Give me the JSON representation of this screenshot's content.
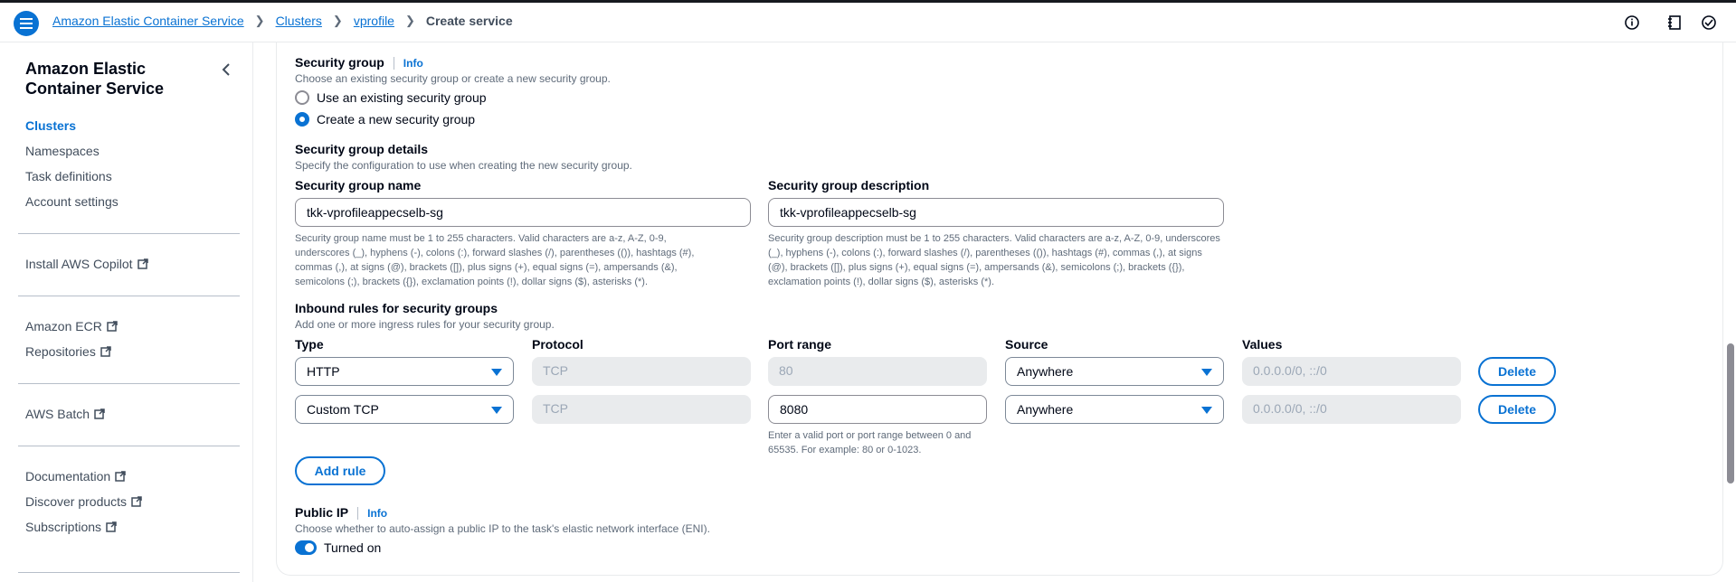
{
  "header": {
    "breadcrumb": [
      "Amazon Elastic Container Service",
      "Clusters",
      "vprofile",
      "Create service"
    ],
    "accent_color": "#0972d3"
  },
  "sidebar": {
    "title": "Amazon Elastic Container Service",
    "items": [
      {
        "label": "Clusters",
        "active": true
      },
      {
        "label": "Namespaces"
      },
      {
        "label": "Task definitions"
      },
      {
        "label": "Account settings"
      },
      {
        "label": "Install AWS Copilot",
        "external": true
      },
      {
        "label": "Amazon ECR",
        "external": true
      },
      {
        "label": "Repositories",
        "external": true
      },
      {
        "label": "AWS Batch",
        "external": true
      },
      {
        "label": "Documentation",
        "external": true
      },
      {
        "label": "Discover products",
        "external": true
      },
      {
        "label": "Subscriptions",
        "external": true
      }
    ]
  },
  "security_group": {
    "title": "Security group",
    "info": "Info",
    "description": "Choose an existing security group or create a new security group.",
    "options": [
      "Use an existing security group",
      "Create a new security group"
    ],
    "selected": "Create a new security group",
    "details_title": "Security group details",
    "details_description": "Specify the configuration to use when creating the new security group.",
    "name_label": "Security group name",
    "name_value": "tkk-vprofileappecselb-sg",
    "name_help": "Security group name must be 1 to 255 characters. Valid characters are a-z, A-Z, 0-9, underscores (_), hyphens (-), colons (:), forward slashes (/), parentheses (()), hashtags (#), commas (,), at signs (@), brackets ([]), plus signs (+), equal signs (=), ampersands (&), semicolons (;), brackets ({}), exclamation points (!), dollar signs ($), asterisks (*).",
    "desc_label": "Security group description",
    "desc_value": "tkk-vprofileappecselb-sg",
    "desc_help": "Security group description must be 1 to 255 characters. Valid characters are a-z, A-Z, 0-9, underscores (_), hyphens (-), colons (:), forward slashes (/), parentheses (()), hashtags (#), commas (,), at signs (@), brackets ([]), plus signs (+), equal signs (=), ampersands (&), semicolons (;), brackets ({}), exclamation points (!), dollar signs ($), asterisks (*)."
  },
  "inbound": {
    "title": "Inbound rules for security groups",
    "description": "Add one or more ingress rules for your security group.",
    "columns": [
      "Type",
      "Protocol",
      "Port range",
      "Source",
      "Values"
    ],
    "rules": [
      {
        "type": "HTTP",
        "protocol": "TCP",
        "port": "80",
        "source": "Anywhere",
        "values": "0.0.0.0/0, ::/0",
        "delete": "Delete"
      },
      {
        "type": "Custom TCP",
        "protocol": "TCP",
        "port": "8080",
        "source": "Anywhere",
        "values": "0.0.0.0/0, ::/0",
        "delete": "Delete"
      }
    ],
    "port_help": "Enter a valid port or port range between 0 and 65535. For example: 80 or 0-1023.",
    "add_rule": "Add rule"
  },
  "public_ip": {
    "title": "Public IP",
    "info": "Info",
    "description": "Choose whether to auto-assign a public IP to the task's elastic network interface (ENI).",
    "toggle_label": "Turned on",
    "enabled": true
  }
}
